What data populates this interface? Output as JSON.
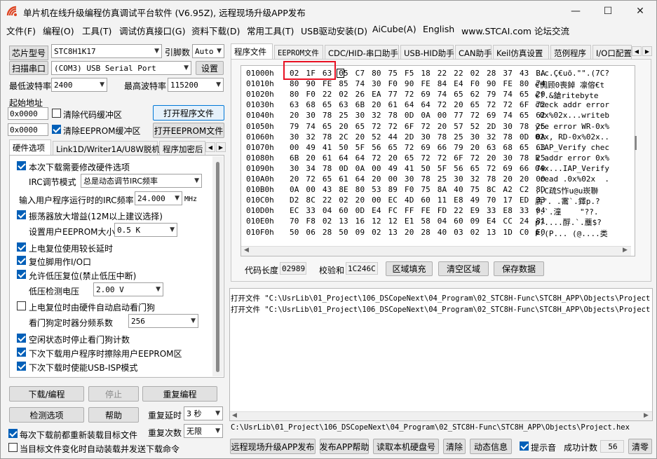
{
  "window": {
    "title": "单片机在线升级编程仿真调试平台软件 (V6.95Z), 远程现场升级APP发布",
    "minimize": "—",
    "maximize": "☐",
    "close": "✕"
  },
  "menu": [
    "文件(F)",
    "编程(O)",
    "工具(T)",
    "调试仿真接口(G)",
    "资料下载(D)",
    "常用工具(T)",
    "USB驱动安装(D)",
    "AiCube(A)",
    "English",
    "www.STCAI.com 论坛交流"
  ],
  "left": {
    "chip_label": "芯片型号",
    "chip_value": "STC8H1K17",
    "pins_label": "引脚数",
    "pins_value": "Auto",
    "scan_button": "扫描串口",
    "port_value": "(COM3) USB Serial Port",
    "settings_button": "设置",
    "min_baud_label": "最低波特率",
    "min_baud_value": "2400",
    "max_baud_label": "最高波特率",
    "max_baud_value": "115200",
    "start_addr_label": "起始地址",
    "code_addr": "0x0000",
    "clear_code_label": "清除代码缓冲区",
    "open_prog_button": "打开程序文件",
    "eeprom_addr": "0x0000",
    "clear_eeprom_label": "清除EEPROM缓冲区",
    "open_eeprom_button": "打开EEPROM文件",
    "tabs": [
      "硬件选项",
      "Link1D/Writer1A/U8W脱机",
      "程序加密后"
    ],
    "options": [
      {
        "label": "本次下载需要修改硬件选项",
        "checked": true
      },
      {
        "label": "IRC调节模式",
        "value": "总是动态调节IRC频率"
      },
      {
        "label": "输入用户程序运行时的IRC频率",
        "value": "24.000",
        "unit": "MHz"
      },
      {
        "label": "振荡器放大增益(12M以上建议选择)",
        "checked": true
      },
      {
        "label": "设置用户EEPROM大小",
        "value": "0.5 K"
      },
      {
        "label": "上电复位使用较长延时",
        "checked": true
      },
      {
        "label": "复位脚用作I/O口",
        "checked": true
      },
      {
        "label": "允许低压复位(禁止低压中断)",
        "checked": true
      },
      {
        "label": "低压检测电压",
        "value": "2.00 V"
      },
      {
        "label": "上电复位时由硬件自动启动看门狗",
        "checked": false
      },
      {
        "label": "看门狗定时器分频系数",
        "value": "256"
      },
      {
        "label": "空闲状态时停止看门狗计数",
        "checked": true
      },
      {
        "label": "下次下载用户程序时擦除用户EEPROM区",
        "checked": true
      },
      {
        "label": "下次下载时使能USB-ISP模式",
        "checked": true
      }
    ],
    "download_button": "下载/编程",
    "stop_button": "停止",
    "reprogram_button": "重复编程",
    "detect_button": "检测选项",
    "help_button": "帮助",
    "repeat_delay_label": "重复延时",
    "repeat_delay_value": "3 秒",
    "repeat_count_label": "重复次数",
    "repeat_count_value": "无限",
    "reload_label": "每次下载前都重新装载目标文件",
    "auto_send_label": "当目标文件变化时自动装载并发送下载命令"
  },
  "right": {
    "tabs": [
      "程序文件",
      "EEPROM文件",
      "CDC/HID-串口助手",
      "USB-HID助手",
      "CAN助手",
      "Keil仿真设置",
      "范例程序",
      "I/O口配置"
    ],
    "hex_rows": [
      {
        "addr": "01000h",
        "bytes": "02 1F 63 05 C7 80 75 F5 18 22 22 02 28 37 43 BA",
        "ascii": "..c.Ç€uõ.\"\".(7C?"
      },
      {
        "addr": "01010h",
        "bytes": "80 90 FE 85 74 30 F0 90 FE 84 E4 F0 90 FE 80 74",
        "ascii": "€惆顾0喪鋽 凛傛€t"
      },
      {
        "addr": "01020h",
        "bytes": "80 F0 22 02 26 EA 77 72 69 74 65 62 79 74 65 20",
        "ascii": "€?.&鎗ritebyte "
      },
      {
        "addr": "01030h",
        "bytes": "63 68 65 63 6B 20 61 64 64 72 20 65 72 72 6F 72",
        "ascii": "check addr error"
      },
      {
        "addr": "01040h",
        "bytes": "20 30 78 25 30 32 78 0D 0A 00 77 72 69 74 65 62",
        "ascii": " 0x%02x...writeb"
      },
      {
        "addr": "01050h",
        "bytes": "79 74 65 20 65 72 72 6F 72 20 57 52 2D 30 78 25",
        "ascii": "yte error WR-0x%"
      },
      {
        "addr": "01060h",
        "bytes": "30 32 78 2C 20 52 44 2D 30 78 25 30 32 78 0D 0A",
        "ascii": "02x, RD-0x%02x.."
      },
      {
        "addr": "01070h",
        "bytes": "00 49 41 50 5F 56 65 72 69 66 79 20 63 68 65 63",
        "ascii": ".IAP_Verify chec"
      },
      {
        "addr": "01080h",
        "bytes": "6B 20 61 64 64 72 20 65 72 72 6F 72 20 30 78 25",
        "ascii": "k addr error 0x%"
      },
      {
        "addr": "01090h",
        "bytes": "30 34 78 0D 0A 00 49 41 50 5F 56 65 72 69 66 79",
        "ascii": "04x...IAP_Verify"
      },
      {
        "addr": "010A0h",
        "bytes": "20 72 65 61 64 20 00 30 78 25 30 32 78 20 20 00",
        "ascii": " read .0x%02x  ."
      },
      {
        "addr": "010B0h",
        "bytes": "0A 00 43 8E 80 53 89 F0 75 8A 40 75 8C A2 C2 8D",
        "ascii": "..C疏S怍u@u崁聨"
      },
      {
        "addr": "010C0h",
        "bytes": "D2 8C 22 02 20 00 EC 4D 60 11 E8 49 70 17 ED 33",
        "ascii": "貭\". .霱`.鐸p.?"
      },
      {
        "addr": "010D0h",
        "bytes": "EC 33 04 60 0D E4 FC FF FE FD 22 E9 33 E8 33 04",
        "ascii": "?.`.潼    \"??."
      },
      {
        "addr": "010E0h",
        "bytes": "70 F8 02 13 16 12 12 E1 58 04 60 09 E4 CC 24 81",
        "ascii": "p?....酻.`.蘪$?"
      },
      {
        "addr": "010F0h",
        "bytes": "50 06 28 50 09 02 13 20 28 40 03 02 13 1D C0 E0",
        "ascii": "P.(P... (@....类"
      }
    ],
    "code_len_label": "代码长度",
    "code_len_value": "02989",
    "checksum_label": "校验和",
    "checksum_value": "1C246C",
    "fill_button": "区域填充",
    "clear_button": "清空区域",
    "save_button": "保存数据",
    "log_lines": [
      "打开文件 \"C:\\UsrLib\\01_Project\\106_DSCopeNext\\04_Program\\02_STC8H-Func\\STC8H_APP\\Objects\\Project.hex",
      "打开文件 \"C:\\UsrLib\\01_Project\\106_DSCopeNext\\04_Program\\02_STC8H-Func\\STC8H_APP\\Objects\\Project.hex"
    ],
    "path": "C:\\UsrLib\\01_Project\\106_DSCopeNext\\04_Program\\02_STC8H-Func\\STC8H_APP\\Objects\\Project.hex",
    "publish_button": "远程现场升级APP发布",
    "publish_help_button": "发布APP帮助",
    "read_hdd_button": "读取本机硬盘号",
    "clear2_button": "清除",
    "anim_button": "动态信息",
    "beep_label": "提示音",
    "success_label": "成功计数",
    "success_value": "56",
    "reset_button": "清零"
  },
  "colors": {
    "accent": "#0078d7",
    "highlight": "#e81123"
  }
}
